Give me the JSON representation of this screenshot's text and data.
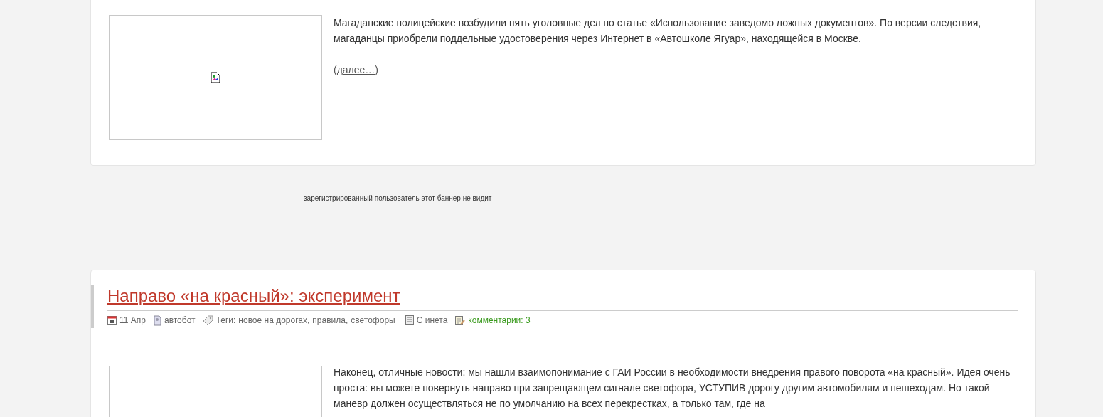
{
  "post_top": {
    "excerpt": "Магаданские полицейские возбудили пять уголовные дел по статье «Использование заведомо ложных документов». По версии следствия, магаданцы приобрели поддельные удостоверения через Интернет в «Автошколе Ягуар», находящейся в Москве.",
    "more_link": "(далее…)"
  },
  "banner_note": "зарегистрированный пользователь этот баннер не видит",
  "post_bottom": {
    "title": "Направо «на красный»: эксперимент",
    "date": "11 Апр",
    "author": "автобот",
    "tags_label": "Теги:",
    "tags": [
      "новое на дорогах",
      "правила",
      "светофоры"
    ],
    "tag_separator": ",",
    "category": "С инета",
    "comments": "комментарии: 3",
    "excerpt": "Наконец, отличные новости: мы нашли взаимопонимание с ГАИ России в необходимости внедрения правого поворота «на красный». Идея очень проста: вы можете повернуть направо при запрещающем сигнале светофора, УСТУПИВ дорогу другим автомобилям и пешеходам. Но такой маневр должен осуществляться не по умолчанию на всех перекрестках, а только там, где на"
  }
}
